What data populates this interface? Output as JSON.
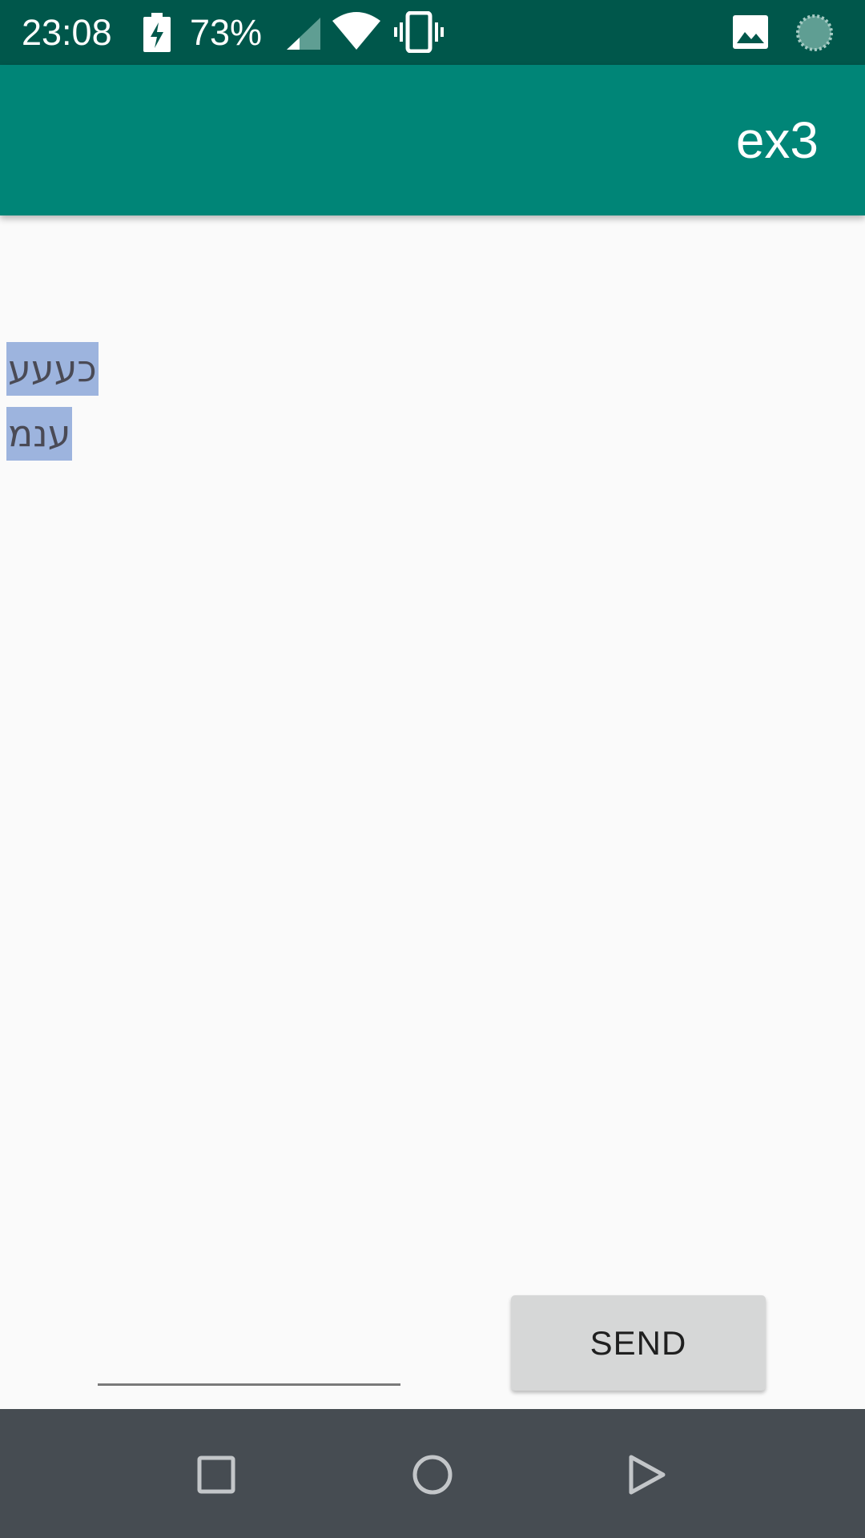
{
  "status_bar": {
    "time": "23:08",
    "battery_percent": "73%",
    "icons": [
      "battery-charging-icon",
      "cell-signal-icon",
      "wifi-icon",
      "vibrate-icon",
      "image-icon",
      "sync-icon"
    ]
  },
  "app_bar": {
    "title": "ex3"
  },
  "messages": [
    {
      "text": "כעעע"
    },
    {
      "text": "ענמ"
    }
  ],
  "input": {
    "value": "",
    "placeholder": ""
  },
  "send_button": {
    "label": "SEND"
  },
  "nav_bar": {
    "icons": [
      "recent-apps-icon",
      "home-icon",
      "back-icon"
    ]
  },
  "colors": {
    "status_bar": "#00574b",
    "app_bar": "#008577",
    "message_highlight": "#9db4de",
    "button": "#d6d7d7",
    "nav_bar": "#464c52"
  }
}
